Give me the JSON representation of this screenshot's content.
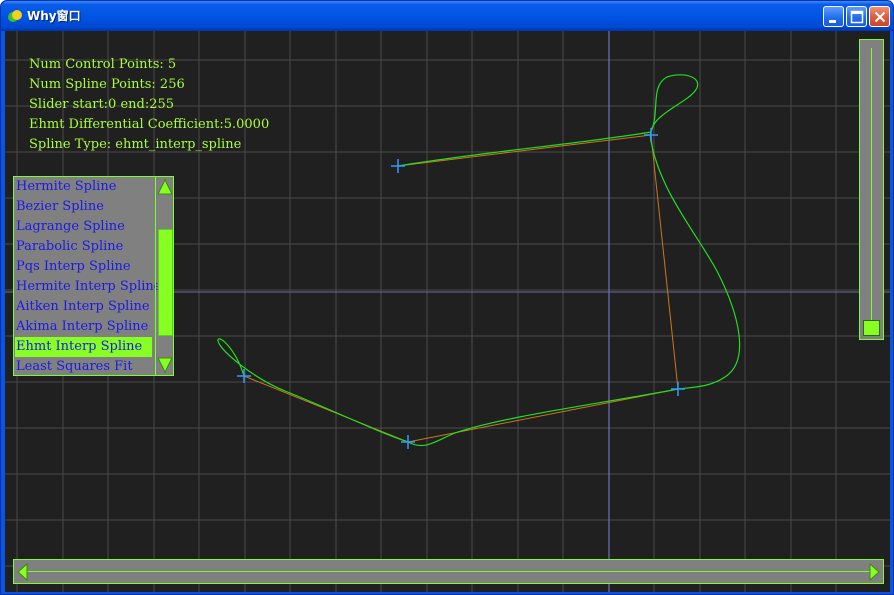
{
  "window": {
    "title": "Why窗口",
    "minimize_label": "minimize",
    "maximize_label": "maximize",
    "close_label": "close"
  },
  "info": {
    "lines": [
      "Num Control Points: 5",
      "Num Spline Points: 256",
      "Slider start:0 end:255",
      "Ehmt Differential Coefficient:5.0000",
      "Spline Type: ehmt_interp_spline"
    ]
  },
  "spline_list": {
    "items": [
      "Hermite Spline",
      "Bezier Spline",
      "Lagrange Spline",
      "Parabolic Spline",
      "Pqs Interp Spline",
      "Hermite Interp Spline",
      "Aitken Interp Spline",
      "Akima Interp Spline",
      "Ehmt Interp Spline",
      "Least Squares Fit"
    ],
    "selected_index": 8
  },
  "colors": {
    "background": "#202020",
    "grid": "#4a4a4a",
    "grid_axis": "#7f7fd8",
    "curve": "#22dd22",
    "control_polygon": "#c87818",
    "control_marker": "#3399ff",
    "text": "#a8ff3c",
    "widget_bg": "#808080",
    "widget_accent": "#88ff22"
  },
  "sliders": {
    "vertical_value": 0.0,
    "horizontal_start": 0,
    "horizontal_end": 255
  }
}
